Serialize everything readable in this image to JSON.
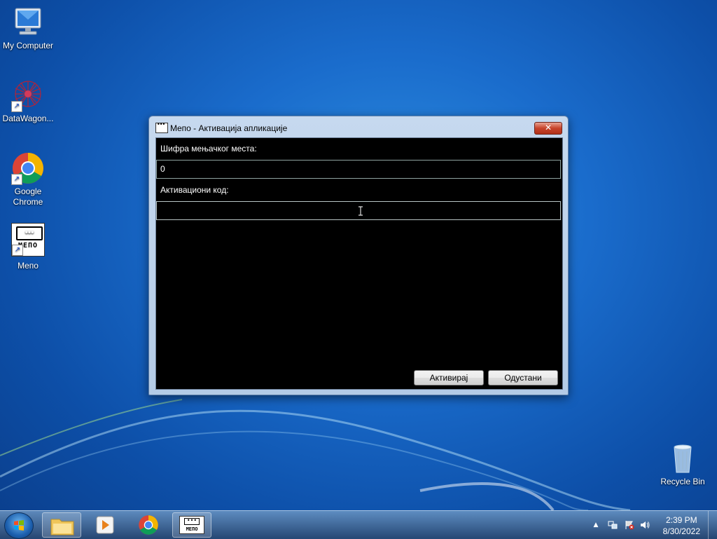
{
  "desktop": {
    "icons": [
      {
        "label": "My Computer"
      },
      {
        "label": "DataWagon..."
      },
      {
        "label": "Google Chrome"
      },
      {
        "label": "Мeпо"
      },
      {
        "label": "Recycle Bin"
      }
    ]
  },
  "window": {
    "title": "Мeпо - Активација апликације",
    "close_label": "✕",
    "fields": [
      {
        "label": "Шифра мењачког места:",
        "value": "0"
      },
      {
        "label": "Активациони код:",
        "value": ""
      }
    ],
    "buttons": {
      "activate": "Активирај",
      "cancel": "Одустани"
    }
  },
  "taskbar": {
    "clock_time": "2:39 PM",
    "clock_date": "8/30/2022",
    "tray_arrow": "▲"
  },
  "app_logo_text": "МЕПО"
}
